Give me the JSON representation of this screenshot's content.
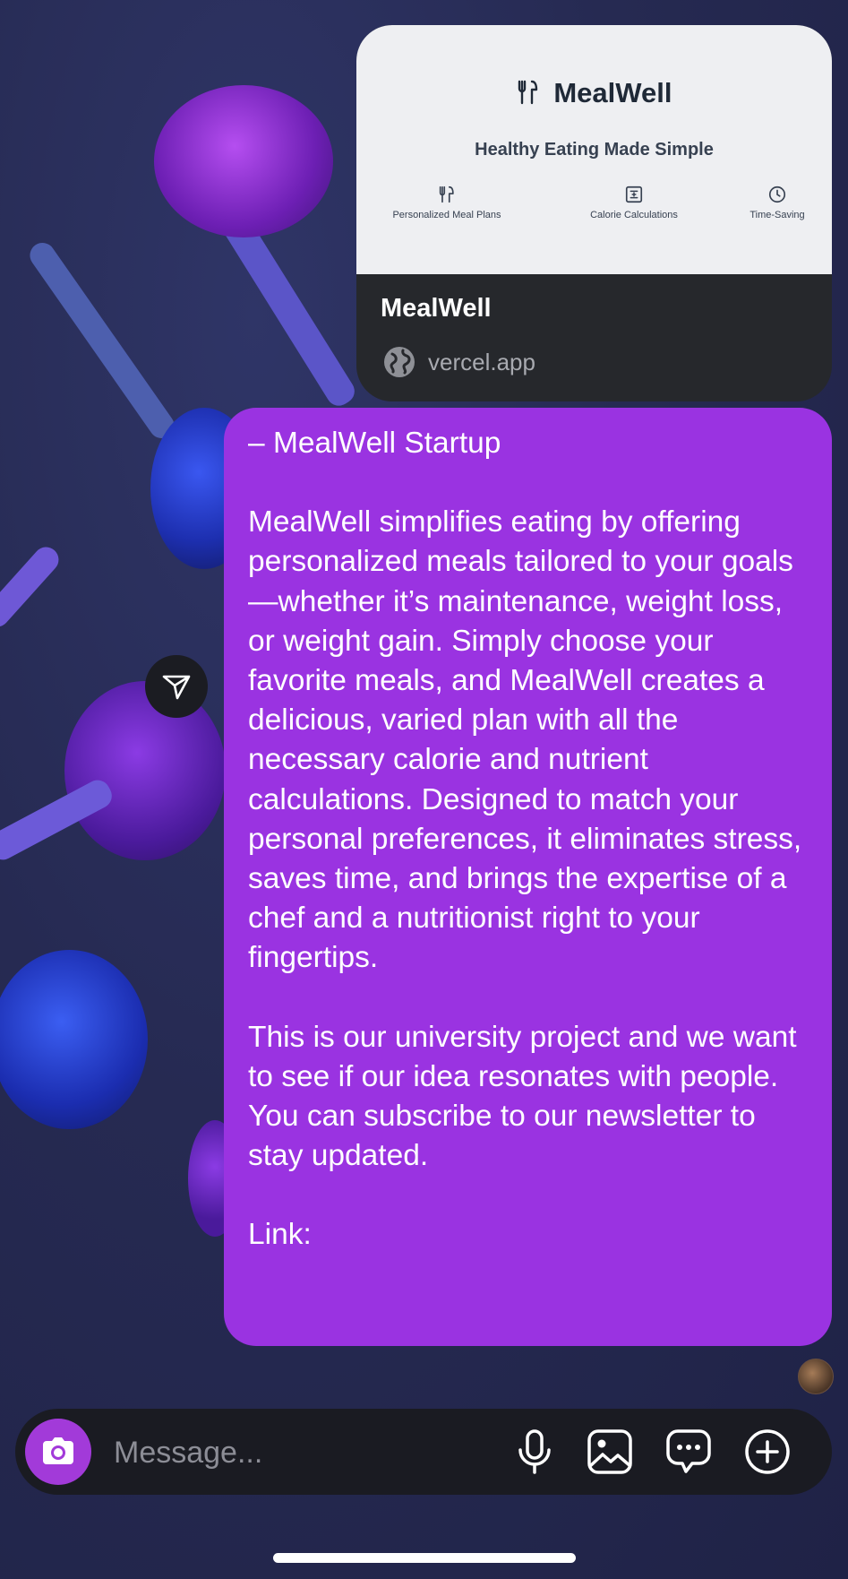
{
  "link_preview": {
    "brand": "MealWell",
    "tagline": "Healthy Eating Made Simple",
    "features": [
      "Personalized Meal Plans",
      "Calorie Calculations",
      "Time-Saving"
    ],
    "title": "MealWell",
    "domain": "vercel.app"
  },
  "message": {
    "heading": "– MealWell Startup",
    "paragraph1": "MealWell simplifies eating by offering personalized meals tailored to your goals—whether it’s maintenance, weight loss, or weight gain. Simply choose your favorite meals, and MealWell creates a delicious, varied plan with all the necessary calorie and nutrient calculations. Designed to match your personal preferences, it eliminates stress, saves time, and brings the expertise of a chef and a nutritionist right to your fingertips.",
    "paragraph2": "This is our university project and we want to see if our idea resonates with people.\nYou can subscribe to our newsletter to stay updated.",
    "link_label": "Link:"
  },
  "composer": {
    "placeholder": "Message...",
    "icons": [
      "camera-icon",
      "microphone-icon",
      "gallery-icon",
      "sticker-icon",
      "plus-icon"
    ]
  },
  "colors": {
    "bubble": "#9a33e1",
    "camera_button": "#a23ad9",
    "preview_footer": "#26282c"
  }
}
